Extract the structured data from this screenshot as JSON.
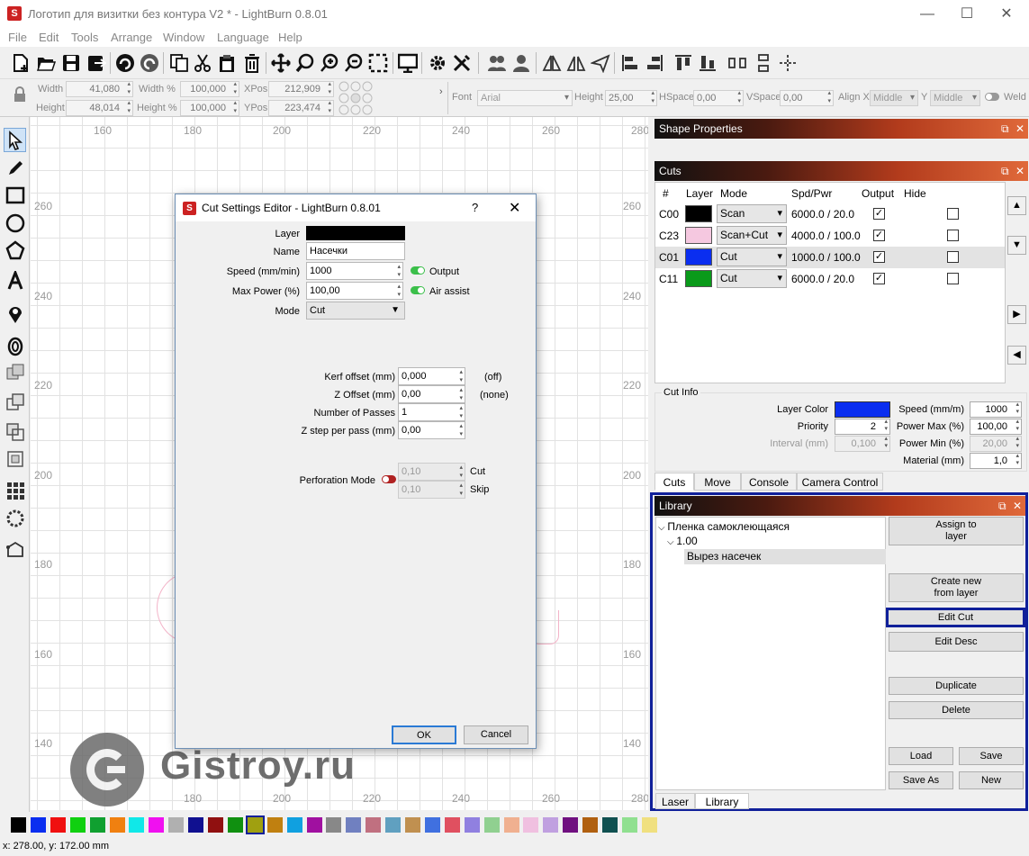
{
  "window": {
    "title": "Логотип для визитки без контура V2 * - LightBurn 0.8.01"
  },
  "menu": [
    "File",
    "Edit",
    "Tools",
    "Arrange",
    "Window",
    "Language",
    "Help"
  ],
  "props": {
    "width_label": "Width",
    "width": "41,080",
    "height_label": "Height",
    "height": "48,014",
    "widthpct_label": "Width %",
    "widthpct": "100,000",
    "heightpct_label": "Height %",
    "heightpct": "100,000",
    "xpos_label": "XPos",
    "xpos": "212,909",
    "ypos_label": "YPos",
    "ypos": "223,474",
    "font_label": "Font",
    "font": "Arial",
    "fheight_label": "Height",
    "fheight": "25,00",
    "hspace_label": "HSpace",
    "hspace": "0,00",
    "vspace_label": "VSpace",
    "vspace": "0,00",
    "alignx_label": "Align X",
    "alignx": "Middle",
    "aligny_label": "Y",
    "aligny": "Middle",
    "weld_label": "Weld"
  },
  "rulers": {
    "top": [
      "160",
      "180",
      "200",
      "220",
      "240",
      "260"
    ],
    "left": [
      "260",
      "240",
      "220",
      "200",
      "180",
      "160",
      "140"
    ],
    "right": [
      "260",
      "240",
      "220",
      "200",
      "180",
      "160",
      "140"
    ],
    "bottom": [
      "180",
      "200",
      "220",
      "240",
      "260"
    ],
    "bottom_right": "280",
    "top_right": "280"
  },
  "dialog": {
    "title": "Cut Settings Editor - LightBurn 0.8.01",
    "help": "?",
    "layer_label": "Layer",
    "layer_color": "#000000",
    "name_label": "Name",
    "name": "Насечки",
    "speed_label": "Speed (mm/min)",
    "speed": "1000",
    "output_label": "Output",
    "maxpower_label": "Max Power (%)",
    "maxpower": "100,00",
    "air_label": "Air assist",
    "mode_label": "Mode",
    "mode": "Cut",
    "kerf_label": "Kerf offset (mm)",
    "kerf": "0,000",
    "kerf_note": "(off)",
    "zoff_label": "Z Offset (mm)",
    "zoff": "0,00",
    "zoff_note": "(none)",
    "passes_label": "Number of Passes",
    "passes": "1",
    "zstep_label": "Z step per pass (mm)",
    "zstep": "0,00",
    "perf_label": "Perforation Mode",
    "perf_cut": "0,10",
    "perf_cut_label": "Cut",
    "perf_skip": "0,10",
    "perf_skip_label": "Skip",
    "ok": "OK",
    "cancel": "Cancel"
  },
  "shape_props": {
    "title": "Shape Properties"
  },
  "cuts": {
    "title": "Cuts",
    "headers": [
      "#",
      "Layer",
      "Mode",
      "Spd/Pwr",
      "Output",
      "Hide"
    ],
    "rows": [
      {
        "id": "C00",
        "color": "#000000",
        "mode": "Scan",
        "spd": "6000.0 / 20.0",
        "output": true,
        "hide": false
      },
      {
        "id": "C23",
        "color": "#f5c8e0",
        "mode": "Scan+Cut",
        "spd": "4000.0 / 100.0",
        "output": true,
        "hide": false
      },
      {
        "id": "C01",
        "color": "#0a2ef0",
        "mode": "Cut",
        "spd": "1000.0 / 100.0",
        "output": true,
        "hide": false
      },
      {
        "id": "C11",
        "color": "#0a9a1a",
        "mode": "Cut",
        "spd": "6000.0 / 20.0",
        "output": true,
        "hide": false
      }
    ],
    "selected_row": 2
  },
  "cutinfo": {
    "title": "Cut Info",
    "layercolor_label": "Layer Color",
    "layercolor": "#0a2ef0",
    "priority_label": "Priority",
    "priority": "2",
    "interval_label": "Interval (mm)",
    "interval": "0,100",
    "speed_label": "Speed (mm/m)",
    "speed": "1000",
    "pmax_label": "Power Max (%)",
    "pmax": "100,00",
    "pmin_label": "Power Min (%)",
    "pmin": "20,00",
    "material_label": "Material (mm)",
    "material": "1,0"
  },
  "tabs": [
    "Cuts",
    "Move",
    "Console",
    "Camera Control"
  ],
  "library": {
    "title": "Library",
    "tree": [
      "Пленка самоклеющаяся",
      "1.00",
      "Вырез насечек"
    ],
    "buttons": {
      "assign": "Assign to\nlayer",
      "create": "Create new\nfrom layer",
      "editcut": "Edit Cut",
      "editdesc": "Edit Desc",
      "duplicate": "Duplicate",
      "delete": "Delete",
      "load": "Load",
      "save": "Save",
      "saveas": "Save As",
      "new": "New"
    },
    "tabs": [
      "Laser",
      "Library"
    ]
  },
  "watermark": {
    "text": "Gistroy.ru"
  },
  "palette": [
    "#000000",
    "#0a2ef0",
    "#f01010",
    "#10d010",
    "#10a030",
    "#f08010",
    "#10e8e8",
    "#f010f0",
    "#b0b0b0",
    "#101090",
    "#901010",
    "#109010",
    "#a0a010",
    "#c08010",
    "#10a0e0",
    "#a010a0",
    "#888888",
    "#7080c0",
    "#c07080",
    "#60a0c0",
    "#c09050",
    "#4070e0",
    "#e05060",
    "#9080e0",
    "#90d090",
    "#f0b090",
    "#f0c0e0",
    "#c0a0e0",
    "#701080",
    "#b06010",
    "#105050",
    "#90e090",
    "#f0e080"
  ],
  "status": {
    "coords": "x: 278.00, y: 172.00 mm"
  },
  "colors": {
    "accent_frame": "#10209a"
  }
}
